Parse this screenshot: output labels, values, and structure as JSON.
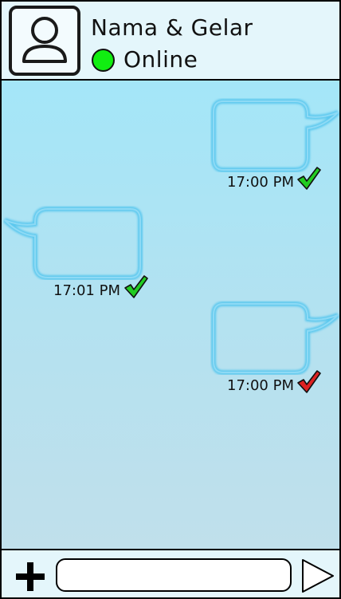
{
  "contact": {
    "name": "Nama & Gelar",
    "status": "Online",
    "status_color": "#11ee11",
    "avatar_icon": "user-icon"
  },
  "messages": [
    {
      "direction": "outgoing",
      "time": "17:00 PM",
      "read_status": "read",
      "check_color": "#22cc22"
    },
    {
      "direction": "incoming",
      "time": "17:01 PM",
      "read_status": "read",
      "check_color": "#22cc22"
    },
    {
      "direction": "outgoing",
      "time": "17:00 PM",
      "read_status": "unread",
      "check_color": "#dd2222"
    }
  ],
  "composer": {
    "add_icon": "plus-icon",
    "input_value": "",
    "input_placeholder": "",
    "send_icon": "send-icon"
  },
  "colors": {
    "bubble_border": "#5cc8ee",
    "chat_background_top": "#a4e6f8",
    "chat_background_bottom": "#c0e0eb",
    "header_background": "#e4f6fb"
  }
}
